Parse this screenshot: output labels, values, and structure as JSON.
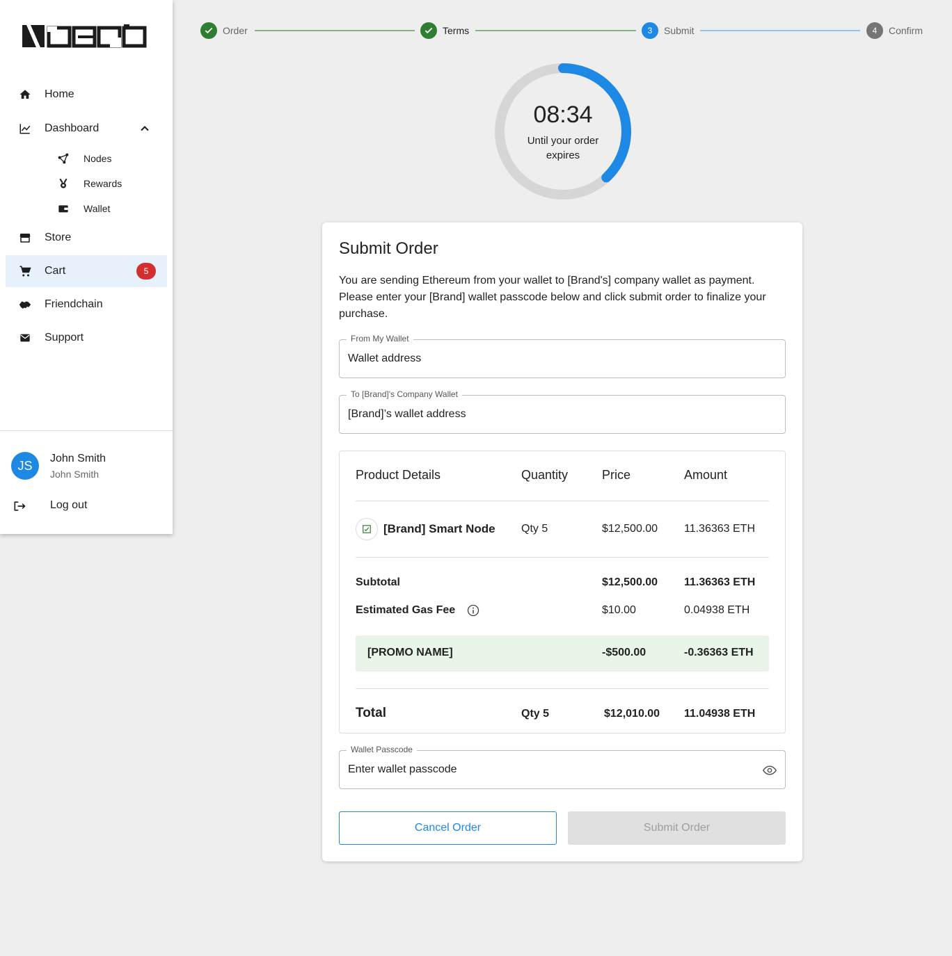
{
  "brand": {
    "logo_text": "nero"
  },
  "sidebar": {
    "items": [
      {
        "label": "Home",
        "icon": "home-icon"
      },
      {
        "label": "Dashboard",
        "icon": "chart-icon"
      },
      {
        "label": "Store",
        "icon": "store-icon"
      },
      {
        "label": "Cart",
        "icon": "cart-icon",
        "badge": "5"
      },
      {
        "label": "Friendchain",
        "icon": "handshake-icon"
      },
      {
        "label": "Support",
        "icon": "mail-icon"
      }
    ],
    "subitems": [
      {
        "label": "Nodes",
        "icon": "nodes-icon"
      },
      {
        "label": "Rewards",
        "icon": "medal-icon"
      },
      {
        "label": "Wallet",
        "icon": "wallet-icon"
      }
    ],
    "user": {
      "initials": "JS",
      "name": "John Smith",
      "sub": "John Smith"
    },
    "logout_label": "Log out"
  },
  "stepper": {
    "steps": [
      {
        "label": "Order",
        "state": "done"
      },
      {
        "label": "Terms",
        "state": "done"
      },
      {
        "label": "Submit",
        "state": "active",
        "number": "3"
      },
      {
        "label": "Confirm",
        "state": "pending",
        "number": "4"
      }
    ]
  },
  "timer": {
    "time": "08:34",
    "text": "Until your order expires",
    "progress": 0.38
  },
  "card": {
    "title": "Submit Order",
    "description": "You are sending Ethereum from your wallet to [Brand's] company wallet as payment. Please enter your [Brand] wallet passcode below and click submit order to finalize your purchase.",
    "from_label": "From My Wallet",
    "from_value": "Wallet address",
    "to_label": "To [Brand]'s Company Wallet",
    "to_value": "[Brand]’s wallet address",
    "passcode_label": "Wallet Passcode",
    "passcode_placeholder": "Enter wallet passcode",
    "cancel_label": "Cancel Order",
    "submit_label": "Submit Order"
  },
  "summary": {
    "headers": {
      "product": "Product Details",
      "quantity": "Quantity",
      "price": "Price",
      "amount": "Amount"
    },
    "product": {
      "name": "[Brand] Smart Node",
      "qty": "Qty 5",
      "price": "$12,500.00",
      "amount": "11.36363 ETH"
    },
    "subtotal": {
      "label": "Subtotal",
      "price": "$12,500.00",
      "amount": "11.36363 ETH"
    },
    "gas": {
      "label": "Estimated Gas Fee",
      "price": "$10.00",
      "amount": "0.04938 ETH"
    },
    "promo": {
      "label": "[PROMO NAME]",
      "price": "-$500.00",
      "amount": "-0.36363 ETH"
    },
    "total": {
      "label": "Total",
      "qty": "Qty 5",
      "price": "$12,010.00",
      "amount": "11.04938 ETH"
    }
  },
  "colors": {
    "accent": "#1e88e5",
    "done": "#2e7d32",
    "pending": "#757575",
    "badge": "#d32f2f"
  }
}
